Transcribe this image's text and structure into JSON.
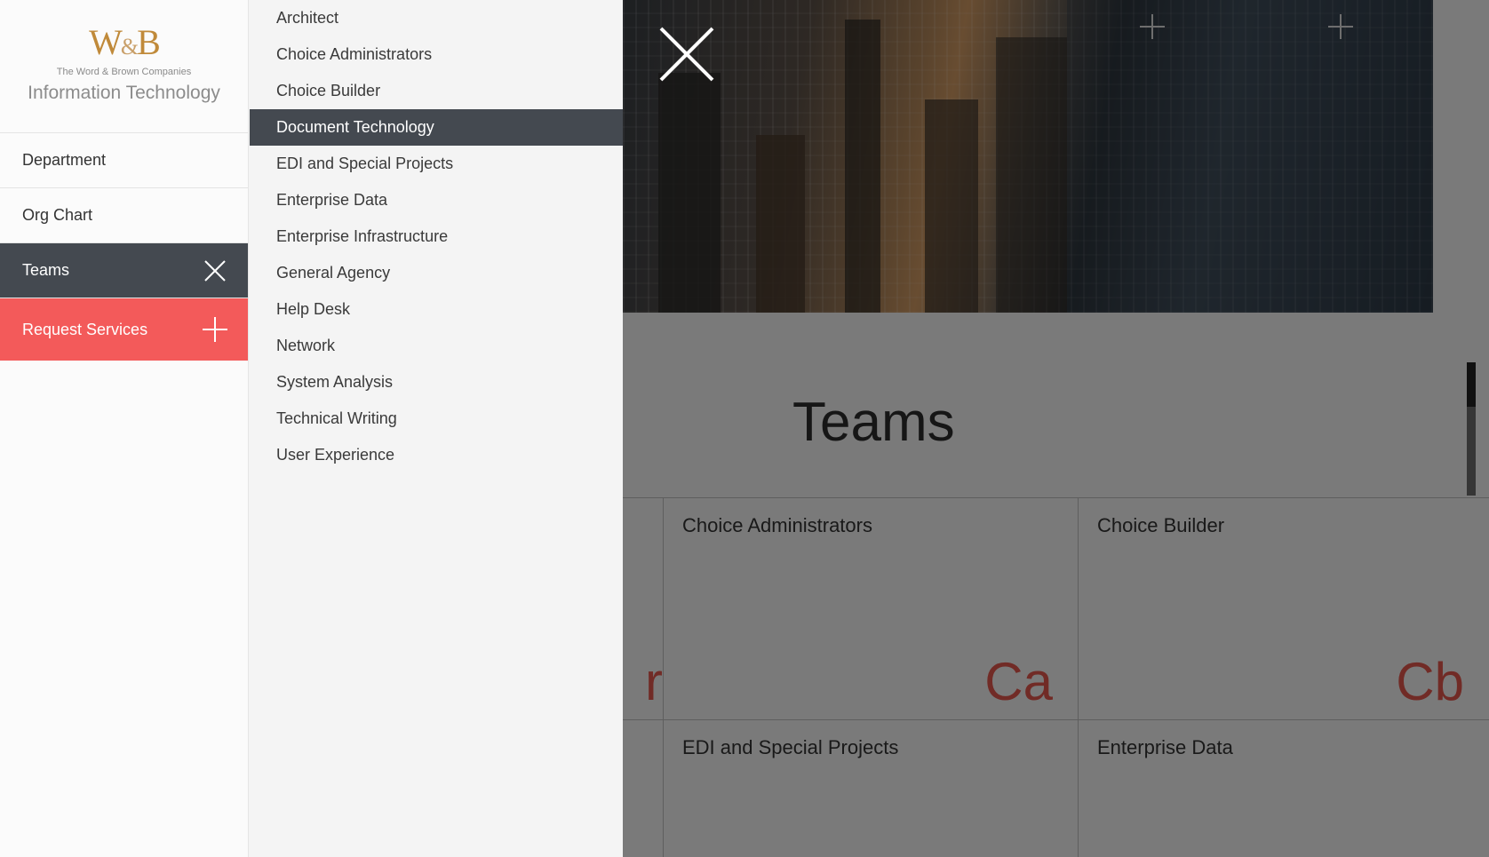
{
  "logo": {
    "mark_left": "W",
    "mark_amp": "&",
    "mark_right": "B",
    "company": "The Word & Brown Companies",
    "title": "Information Technology"
  },
  "nav": {
    "items": [
      {
        "label": "Department"
      },
      {
        "label": "Org Chart"
      },
      {
        "label": "Teams"
      },
      {
        "label": "Request Services"
      }
    ]
  },
  "team_menu": {
    "items": [
      "Architect",
      "Choice Administrators",
      "Choice Builder",
      "Document Technology",
      "EDI and Special Projects",
      "Enterprise Data",
      "Enterprise Infrastructure",
      "General Agency",
      "Help Desk",
      "Network",
      "System Analysis",
      "Technical Writing",
      "User Experience"
    ],
    "selected": "Document Technology"
  },
  "main": {
    "heading": "Teams",
    "cards": [
      {
        "name": "",
        "abbr": "r"
      },
      {
        "name": "Choice Administrators",
        "abbr": "Ca"
      },
      {
        "name": "Choice Builder",
        "abbr": "Cb"
      },
      {
        "name": "",
        "abbr": ""
      },
      {
        "name": "EDI and Special Projects",
        "abbr": ""
      },
      {
        "name": "Enterprise Data",
        "abbr": ""
      }
    ]
  },
  "colors": {
    "accent": "#f35a5a",
    "active_nav": "#444950",
    "logo_gold": "#c08a3a",
    "card_abbr": "#e2574c"
  }
}
